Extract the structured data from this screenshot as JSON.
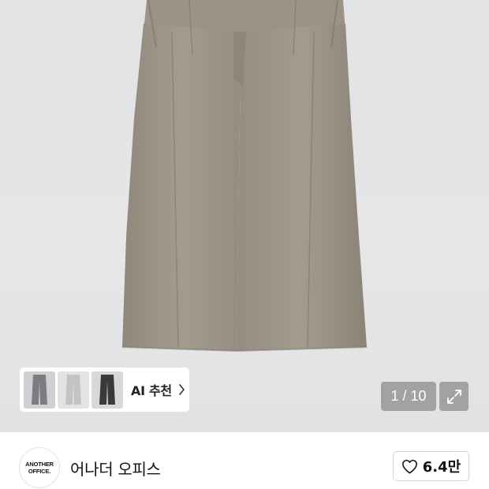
{
  "product_image": {
    "alt_icon": "pants-photo",
    "background_color": "#e4e4e6",
    "garment_color": "#9a9284"
  },
  "ai_recommendation": {
    "label": "AI 추천",
    "thumbnail_colors": [
      "#7b7d82",
      "#c3c3c1",
      "#3a3a3c"
    ],
    "chevron_icon": "chevron-right-icon"
  },
  "gallery": {
    "page_counter": "1 / 10",
    "expand_icon": "expand-icon"
  },
  "brand": {
    "logo_line1": "ANOTHER",
    "logo_line2": "OFFICE.",
    "name": "어나더 오피스"
  },
  "like": {
    "icon": "heart-icon",
    "count": "6.4만"
  }
}
